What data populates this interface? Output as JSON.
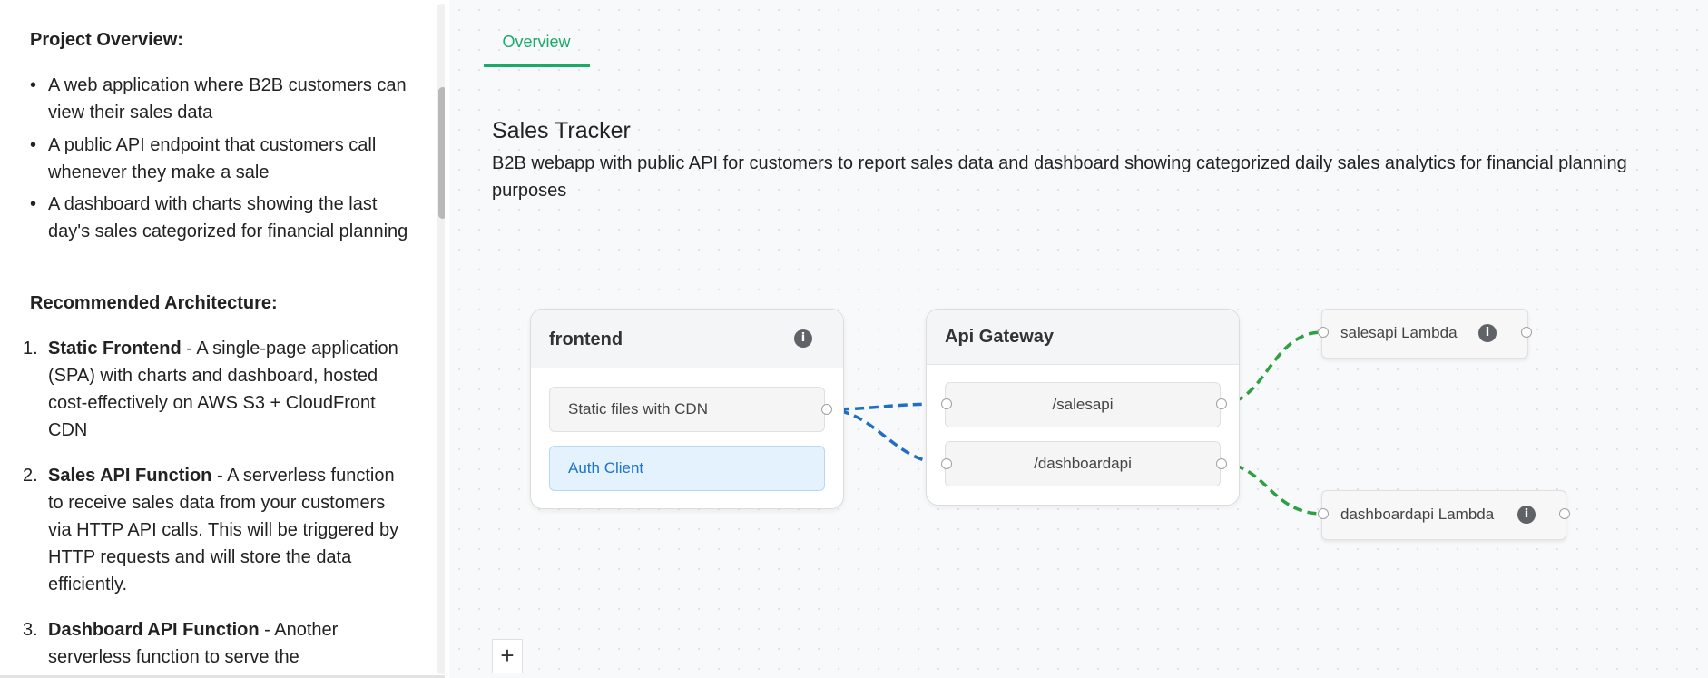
{
  "left_panel": {
    "project_overview_heading": "Project Overview:",
    "overview_items": [
      "A web application where B2B customers can view their sales data",
      "A public API endpoint that customers call whenever they make a sale",
      "A dashboard with charts showing the last day's sales categorized for financial planning"
    ],
    "architecture_heading": "Recommended Architecture:",
    "architecture_items": [
      {
        "number": "1.",
        "title": "Static Frontend",
        "text": " - A single-page application (SPA) with charts and dashboard, hosted cost-effectively on AWS S3 + CloudFront CDN"
      },
      {
        "number": "2.",
        "title": "Sales API Function",
        "text": " - A serverless function to receive sales data from your customers via HTTP API calls. This will be triggered by HTTP requests and will store the data efficiently."
      },
      {
        "number": "3.",
        "title": "Dashboard API Function",
        "text": " - Another serverless function to serve the"
      }
    ]
  },
  "tabs": [
    {
      "label": "Overview",
      "active": true
    }
  ],
  "app": {
    "title": "Sales Tracker",
    "description": "B2B webapp with public API for customers to report sales data and dashboard showing categorized daily sales analytics for financial planning purposes"
  },
  "diagram": {
    "frontend": {
      "title": "frontend",
      "items": [
        "Static files with CDN",
        "Auth Client"
      ]
    },
    "api_gateway": {
      "title": "Api Gateway",
      "routes": [
        "/salesapi",
        "/dashboardapi"
      ]
    },
    "lambdas": [
      "salesapi Lambda",
      "dashboardapi Lambda"
    ],
    "edge_colors": {
      "frontend": "#1f6fc5",
      "lambda": "#2ea043"
    }
  },
  "controls": {
    "zoom_in": "+"
  },
  "colors": {
    "accent": "#1aaa6a",
    "auth_bg": "#e3f2fd",
    "auth_text": "#1f74c9"
  }
}
